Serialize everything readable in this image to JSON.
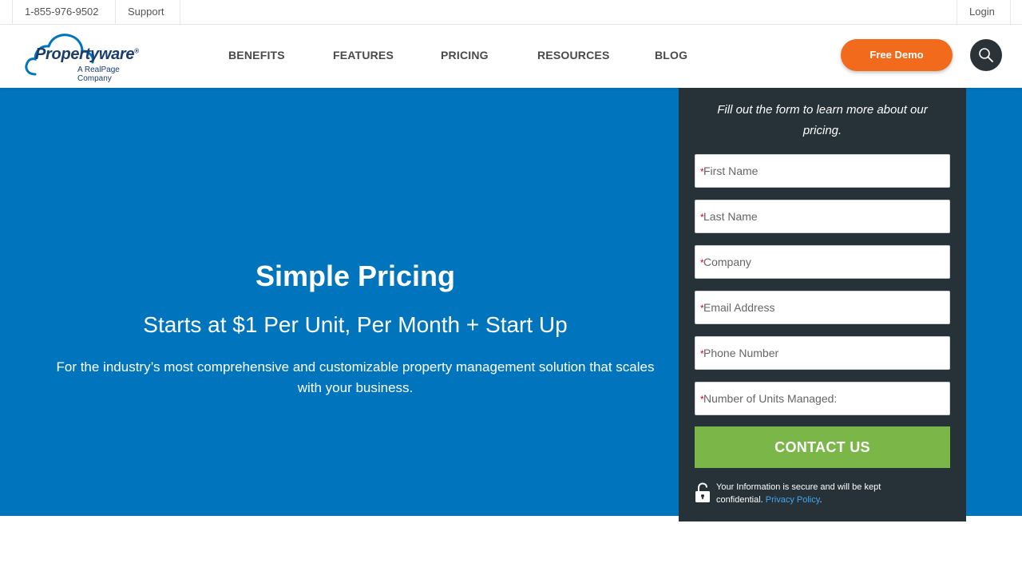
{
  "topbar": {
    "phone": "1-855-976-9502",
    "support": "Support",
    "login": "Login"
  },
  "header": {
    "logo": {
      "wordmark": "Propertyware",
      "registered": "®",
      "tagline": "A RealPage Company"
    },
    "nav": [
      {
        "label": "BENEFITS"
      },
      {
        "label": "FEATURES"
      },
      {
        "label": "PRICING"
      },
      {
        "label": "RESOURCES"
      },
      {
        "label": "BLOG"
      }
    ],
    "demo_button": "Free Demo",
    "search_icon": "search-icon"
  },
  "hero": {
    "title": "Simple Pricing",
    "subtitle": "Starts at $1 Per Unit, Per Month + Start Up",
    "description": "For the industry’s most comprehensive and customizable property management solution that scales with your business."
  },
  "form": {
    "intro": "Fill out the form to learn more about our pricing.",
    "required_marker": "*",
    "fields": [
      {
        "placeholder": "First Name",
        "value": ""
      },
      {
        "placeholder": "Last Name",
        "value": ""
      },
      {
        "placeholder": "Company",
        "value": ""
      },
      {
        "placeholder": "Email Address",
        "value": ""
      },
      {
        "placeholder": "Phone Number",
        "value": ""
      },
      {
        "placeholder": "Number of Units Managed:",
        "value": ""
      }
    ],
    "submit_label": "CONTACT US",
    "secure_text": "Your Information is secure and will be kept confidential.",
    "privacy_link": "Privacy Policy",
    "privacy_suffix": ".",
    "lock_icon": "padlock-icon"
  },
  "colors": {
    "hero_bg": "#0075be",
    "form_bg": "#263238",
    "demo_button": "#f26b1d",
    "contact_button": "#7ab648",
    "logo_blue": "#1a3d6e",
    "link": "#3fa9f5"
  }
}
